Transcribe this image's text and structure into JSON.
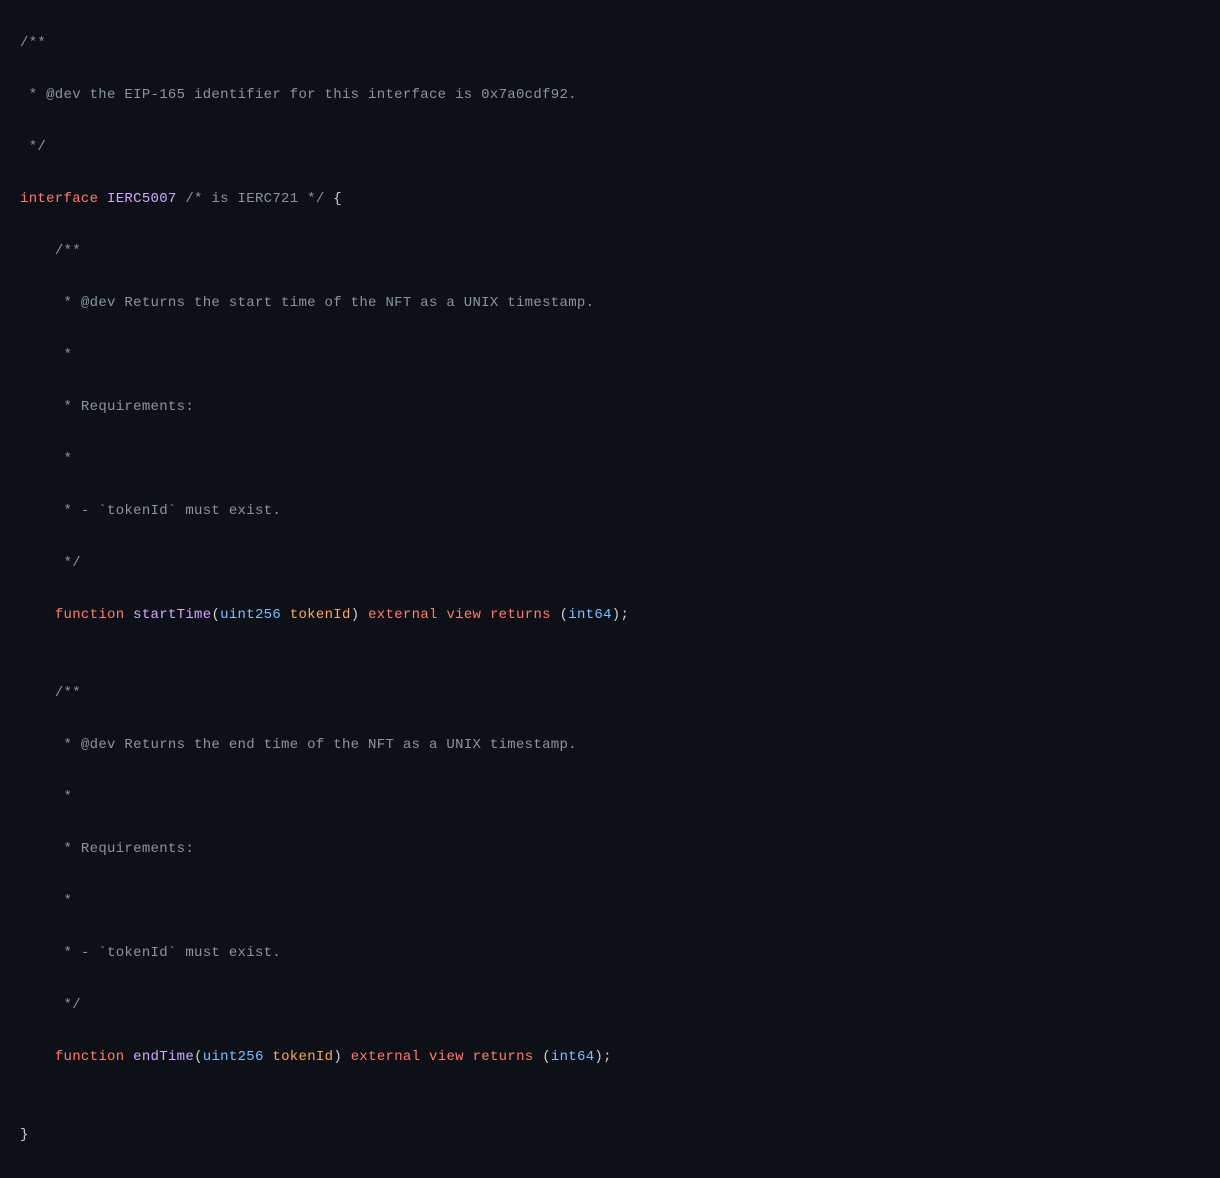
{
  "code": {
    "docComment1_line1": "/**",
    "docComment1_line2": " * @dev the EIP-165 identifier for this interface is 0x7a0cdf92.",
    "docComment1_line3": " */",
    "interface_keyword": "interface",
    "interface_name": "IERC5007",
    "interface_comment": "/* is IERC721 */",
    "brace_open": "{",
    "docComment2_line1": "/**",
    "docComment2_line2": " * @dev Returns the start time of the NFT as a UNIX timestamp.",
    "docComment2_line3": " *",
    "docComment2_line4": " * Requirements:",
    "docComment2_line5": " *",
    "docComment2_line6": " * - `tokenId` must exist.",
    "docComment2_line7": " */",
    "function_keyword": "function",
    "func1_name": "startTime",
    "paren_open": "(",
    "uint256": "uint256",
    "tokenId": "tokenId",
    "paren_close": ")",
    "external": "external",
    "view": "view",
    "returns": "returns",
    "int64": "int64",
    "semicolon": ";",
    "docComment3_line1": "/**",
    "docComment3_line2": " * @dev Returns the end time of the NFT as a UNIX timestamp.",
    "docComment3_line3": " *",
    "docComment3_line4": " * Requirements:",
    "docComment3_line5": " *",
    "docComment3_line6": " * - `tokenId` must exist.",
    "docComment3_line7": " */",
    "func2_name": "endTime",
    "brace_close": "}",
    "space": " ",
    "indent": "    ",
    "empty": ""
  }
}
